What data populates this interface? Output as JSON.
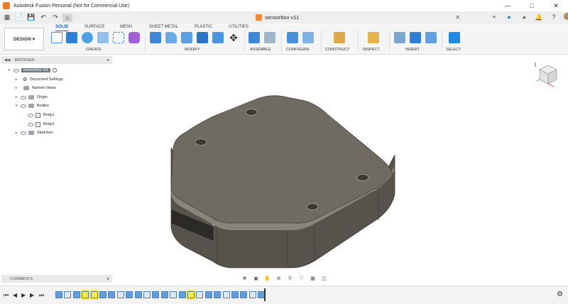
{
  "window": {
    "title": "Autodesk Fusion Personal (Not for Commercial Use)",
    "controls": [
      "minimize-icon",
      "maximize-icon",
      "close-icon"
    ]
  },
  "document_tab": {
    "name": "sensorbox v11"
  },
  "workspace": {
    "label": "DESIGN"
  },
  "ribbon_tabs": [
    "SOLID",
    "SURFACE",
    "MESH",
    "SHEET METAL",
    "PLASTIC",
    "UTILITIES"
  ],
  "active_tab": "SOLID",
  "tool_groups": [
    "CREATE",
    "MODIFY",
    "ASSEMBLE",
    "CONFIGURE",
    "CONSTRUCT",
    "INSPECT",
    "INSERT",
    "SELECT"
  ],
  "browser": {
    "header": "BROWSER",
    "root": "sensorbox v11",
    "items": [
      {
        "label": "Document Settings",
        "kind": "settings"
      },
      {
        "label": "Named Views",
        "kind": "folder"
      },
      {
        "label": "Origin",
        "kind": "folder"
      },
      {
        "label": "Bodies",
        "kind": "folder"
      },
      {
        "label": "Body1",
        "kind": "body"
      },
      {
        "label": "Body2",
        "kind": "body"
      },
      {
        "label": "Sketches",
        "kind": "folder"
      }
    ]
  },
  "comments": {
    "header": "COMMENTS"
  },
  "colors": {
    "accent": "#0a68c5",
    "model_top": "#6e6a61",
    "model_side": "#56534c",
    "timeline_highlight": "#ffe94a"
  }
}
